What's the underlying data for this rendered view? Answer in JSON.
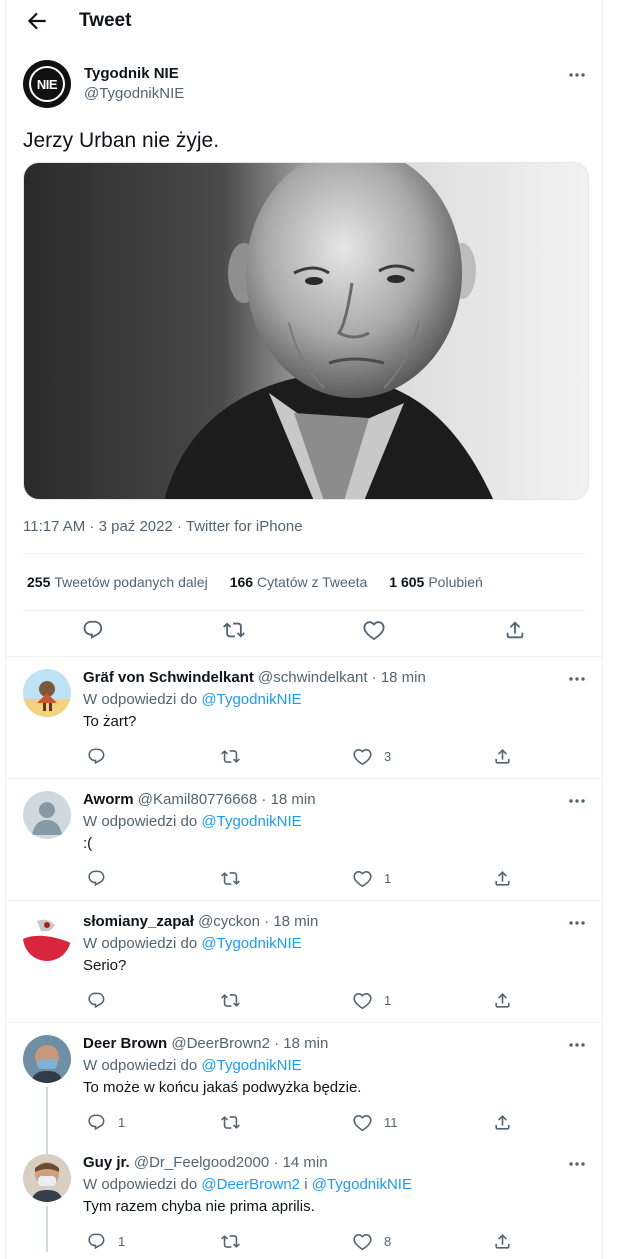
{
  "header": {
    "title": "Tweet"
  },
  "tweet": {
    "avatar_text": "NIE",
    "author_name": "Tygodnik NIE",
    "author_handle": "@TygodnikNIE",
    "text": "Jerzy Urban nie żyje.",
    "meta": "11:17 AM · 3 paź 2022 · Twitter for iPhone",
    "stats": {
      "retweets_count": "255",
      "retweets_label": "Tweetów podanych dalej",
      "quotes_count": "166",
      "quotes_label": "Cytatów z Tweeta",
      "likes_count": "1 605",
      "likes_label": "Polubień"
    }
  },
  "replies": [
    {
      "name": "Gräf von Schwindelkant",
      "handle": "@schwindelkant",
      "time": "· 18 min",
      "reply_prefix": "W odpowiedzi do",
      "mention1": "@TygodnikNIE",
      "mention_joiner": "",
      "mention2": "",
      "text": "To żart?",
      "reply_count": "",
      "like_count": "3"
    },
    {
      "name": "Aworm",
      "handle": "@Kamil80776668",
      "time": "· 18 min",
      "reply_prefix": "W odpowiedzi do",
      "mention1": "@TygodnikNIE",
      "mention_joiner": "",
      "mention2": "",
      "text": ":(",
      "reply_count": "",
      "like_count": "1"
    },
    {
      "name": "słomiany_zapał",
      "handle": "@cyckon",
      "time": "· 18 min",
      "reply_prefix": "W odpowiedzi do",
      "mention1": "@TygodnikNIE",
      "mention_joiner": "",
      "mention2": "",
      "text": "Serio?",
      "reply_count": "",
      "like_count": "1"
    },
    {
      "name": "Deer Brown",
      "handle": "@DeerBrown2",
      "time": "· 18 min",
      "reply_prefix": "W odpowiedzi do",
      "mention1": "@TygodnikNIE",
      "mention_joiner": "",
      "mention2": "",
      "text": "To może w końcu jakaś podwyżka będzie.",
      "reply_count": "1",
      "like_count": "11"
    },
    {
      "name": "Guy jr.",
      "handle": "@Dr_Feelgood2000",
      "time": "· 14 min",
      "reply_prefix": "W odpowiedzi do",
      "mention1": "@DeerBrown2",
      "mention_joiner": "i",
      "mention2": "@TygodnikNIE",
      "text": "Tym razem chyba nie prima aprilis.",
      "reply_count": "1",
      "like_count": "8"
    }
  ],
  "icons": {
    "back": "arrow-left-icon",
    "more": "more-horizontal-icon",
    "reply": "reply-icon",
    "retweet": "retweet-icon",
    "like": "heart-icon",
    "share": "share-icon"
  },
  "colors": {
    "link": "#1d9bf0",
    "secondary_text": "#536471",
    "primary_text": "#0f1419",
    "divider": "#eff3f4"
  }
}
